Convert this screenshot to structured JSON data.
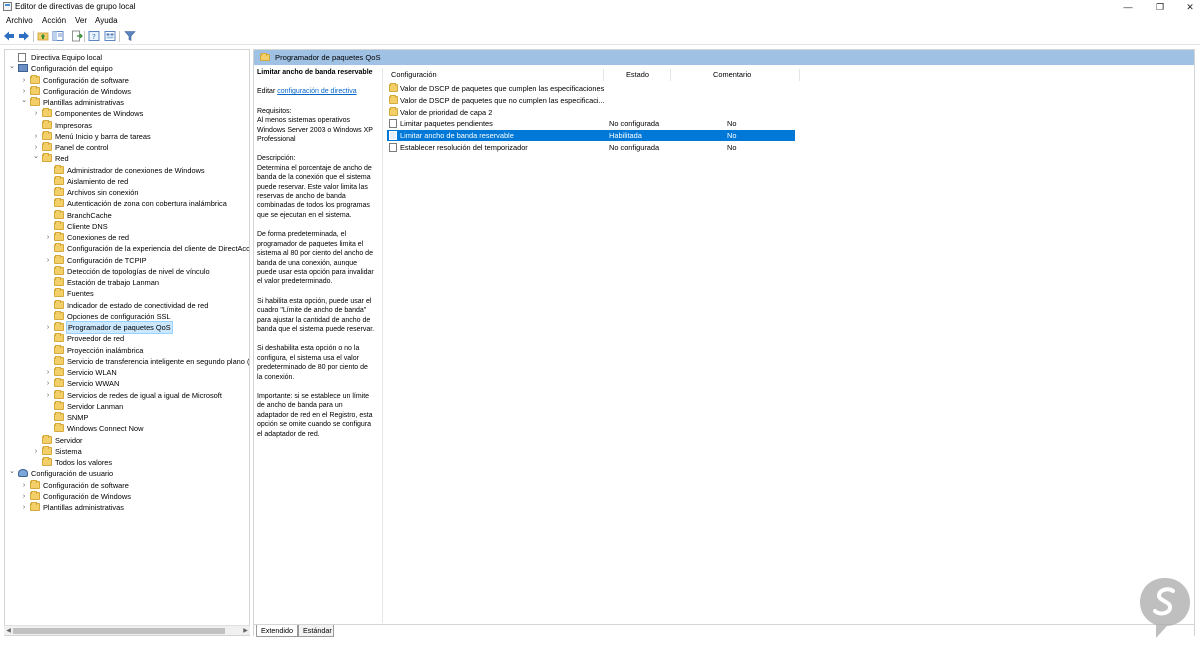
{
  "window": {
    "title": "Editor de directivas de grupo local",
    "controls": {
      "minimize": "—",
      "maximize": "❐",
      "close": "✕"
    }
  },
  "menu": [
    "Archivo",
    "Acción",
    "Ver",
    "Ayuda"
  ],
  "toolbar_icons": [
    "back-arrow-icon",
    "forward-arrow-icon",
    "up-folder-icon",
    "show-hide-tree-icon",
    "export-list-icon",
    "help-icon",
    "properties-icon",
    "filter-icon"
  ],
  "colors": {
    "header": "#9fc1e3",
    "selection": "#0078d7",
    "link": "#0066cc",
    "folder": "#f3cf6a"
  },
  "tree": {
    "rows": [
      {
        "label": "Directiva Equipo local",
        "level": 0,
        "icon": "doc",
        "chev": ""
      },
      {
        "label": "Configuración del equipo",
        "level": 0,
        "icon": "computer",
        "chev": "v"
      },
      {
        "label": "Configuración de software",
        "level": 1,
        "icon": "folder",
        "chev": ">"
      },
      {
        "label": "Configuración de Windows",
        "level": 1,
        "icon": "folder",
        "chev": ">"
      },
      {
        "label": "Plantillas administrativas",
        "level": 1,
        "icon": "folder",
        "chev": "v"
      },
      {
        "label": "Componentes de Windows",
        "level": 2,
        "icon": "folder",
        "chev": ">"
      },
      {
        "label": "Impresoras",
        "level": 2,
        "icon": "folder",
        "chev": ""
      },
      {
        "label": "Menú Inicio y barra de tareas",
        "level": 2,
        "icon": "folder",
        "chev": ">"
      },
      {
        "label": "Panel de control",
        "level": 2,
        "icon": "folder",
        "chev": ">"
      },
      {
        "label": "Red",
        "level": 2,
        "icon": "folder",
        "chev": "v"
      },
      {
        "label": "Administrador de conexiones de Windows",
        "level": 3,
        "icon": "folder",
        "chev": ""
      },
      {
        "label": "Aislamiento de red",
        "level": 3,
        "icon": "folder",
        "chev": ""
      },
      {
        "label": "Archivos sin conexión",
        "level": 3,
        "icon": "folder",
        "chev": ""
      },
      {
        "label": "Autenticación de zona con cobertura inalámbrica",
        "level": 3,
        "icon": "folder",
        "chev": ""
      },
      {
        "label": "BranchCache",
        "level": 3,
        "icon": "folder",
        "chev": ""
      },
      {
        "label": "Cliente DNS",
        "level": 3,
        "icon": "folder",
        "chev": ""
      },
      {
        "label": "Conexiones de red",
        "level": 3,
        "icon": "folder",
        "chev": ">"
      },
      {
        "label": "Configuración de la experiencia del cliente de DirectAcc",
        "level": 3,
        "icon": "folder",
        "chev": ""
      },
      {
        "label": "Configuración de TCPIP",
        "level": 3,
        "icon": "folder",
        "chev": ">"
      },
      {
        "label": "Detección de topologías de nivel de vínculo",
        "level": 3,
        "icon": "folder",
        "chev": ""
      },
      {
        "label": "Estación de trabajo Lanman",
        "level": 3,
        "icon": "folder",
        "chev": ""
      },
      {
        "label": "Fuentes",
        "level": 3,
        "icon": "folder",
        "chev": ""
      },
      {
        "label": "Indicador de estado de conectividad de red",
        "level": 3,
        "icon": "folder",
        "chev": ""
      },
      {
        "label": "Opciones de configuración SSL",
        "level": 3,
        "icon": "folder",
        "chev": ""
      },
      {
        "label": "Programador de paquetes QoS",
        "level": 3,
        "icon": "folder",
        "chev": ">",
        "selected": true
      },
      {
        "label": "Proveedor de red",
        "level": 3,
        "icon": "folder",
        "chev": ""
      },
      {
        "label": "Proyección inalámbrica",
        "level": 3,
        "icon": "folder",
        "chev": ""
      },
      {
        "label": "Servicio de transferencia inteligente en segundo plano (",
        "level": 3,
        "icon": "folder",
        "chev": ""
      },
      {
        "label": "Servicio WLAN",
        "level": 3,
        "icon": "folder",
        "chev": ">"
      },
      {
        "label": "Servicio WWAN",
        "level": 3,
        "icon": "folder",
        "chev": ">"
      },
      {
        "label": "Servicios de redes de igual a igual de Microsoft",
        "level": 3,
        "icon": "folder",
        "chev": ">"
      },
      {
        "label": "Servidor Lanman",
        "level": 3,
        "icon": "folder",
        "chev": ""
      },
      {
        "label": "SNMP",
        "level": 3,
        "icon": "folder",
        "chev": ""
      },
      {
        "label": "Windows Connect Now",
        "level": 3,
        "icon": "folder",
        "chev": ""
      },
      {
        "label": "Servidor",
        "level": 2,
        "icon": "folder",
        "chev": ""
      },
      {
        "label": "Sistema",
        "level": 2,
        "icon": "folder",
        "chev": ">"
      },
      {
        "label": "Todos los valores",
        "level": 2,
        "icon": "folder",
        "chev": ""
      },
      {
        "label": "Configuración de usuario",
        "level": 0,
        "icon": "user",
        "chev": "v"
      },
      {
        "label": "Configuración de software",
        "level": 1,
        "icon": "folder",
        "chev": ">"
      },
      {
        "label": "Configuración de Windows",
        "level": 1,
        "icon": "folder",
        "chev": ">"
      },
      {
        "label": "Plantillas administrativas",
        "level": 1,
        "icon": "folder",
        "chev": ">"
      }
    ]
  },
  "right": {
    "header_title": "Programador de paquetes QoS",
    "description": {
      "title": "Limitar ancho de banda reservable",
      "edit_prefix": "Editar ",
      "edit_link": "configuración de directiva",
      "requirements": [
        "Requisitos:",
        "Al menos sistemas operativos",
        "Windows Server 2003 o Windows XP",
        "Professional"
      ],
      "paragraphs": [
        [
          "Descripción:",
          "Determina el porcentaje de ancho de",
          "banda de la conexión que el sistema",
          "puede reservar. Este valor limita las",
          "reservas de ancho de banda",
          "combinadas de todos los programas",
          "que se ejecutan en el sistema."
        ],
        [
          "De forma predeterminada, el",
          "programador de paquetes limita el",
          "sistema al 80 por ciento del ancho de",
          "banda de una conexión, aunque",
          "puede usar esta opción para invalidar",
          "el valor predeterminado."
        ],
        [
          "Si habilita esta opción, puede usar el",
          "cuadro \"Límite de ancho de banda\"",
          "para ajustar la cantidad de ancho de",
          "banda que el sistema puede reservar."
        ],
        [
          "Si deshabilita esta opción o no la",
          "configura, el sistema usa el valor",
          "predeterminado de 80 por ciento de",
          "la conexión."
        ],
        [
          "Importante: si se establece un límite",
          "de ancho de banda para un",
          "adaptador de red en el Registro, esta",
          "opción se omite cuando se configura",
          "el adaptador de red."
        ]
      ]
    },
    "columns": {
      "config": "Configuración",
      "state": "Estado",
      "comment": "Comentario"
    },
    "rows": [
      {
        "name": "Valor de DSCP de paquetes que cumplen las especificaciones",
        "state": "",
        "comment": "",
        "icon": "folder"
      },
      {
        "name": "Valor de DSCP de paquetes que no cumplen las especificaci...",
        "state": "",
        "comment": "",
        "icon": "folder"
      },
      {
        "name": "Valor de prioridad de capa 2",
        "state": "",
        "comment": "",
        "icon": "folder"
      },
      {
        "name": "Limitar paquetes pendientes",
        "state": "No configurada",
        "comment": "No",
        "icon": "doc"
      },
      {
        "name": "Limitar ancho de banda reservable",
        "state": "Habilitada",
        "comment": "No",
        "icon": "doc",
        "selected": true
      },
      {
        "name": "Establecer resolución del temporizador",
        "state": "No configurada",
        "comment": "No",
        "icon": "doc"
      }
    ],
    "tabs": [
      "Extendido",
      "Estándar"
    ]
  }
}
